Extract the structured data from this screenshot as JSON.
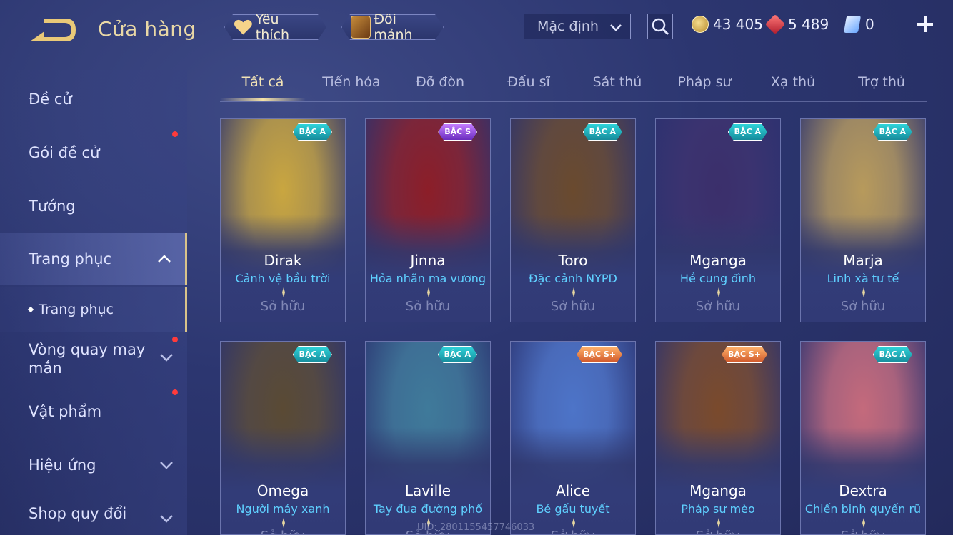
{
  "header": {
    "title": "Cửa hàng",
    "favorite_label": "Yêu thích",
    "fragment_label": "Đổi mảnh",
    "sort_value": "Mặc định"
  },
  "currency": {
    "gold": "43 405",
    "ruby": "5 489",
    "voucher": "0"
  },
  "sidebar": {
    "items": [
      {
        "label": "Đề cử"
      },
      {
        "label": "Gói đề cử"
      },
      {
        "label": "Tướng"
      },
      {
        "label": "Trang phục"
      },
      {
        "label": "Trang phục"
      },
      {
        "label": "Vòng quay may mắn"
      },
      {
        "label": "Vật phẩm"
      },
      {
        "label": "Hiệu ứng"
      },
      {
        "label": "Shop quy đổi"
      }
    ]
  },
  "tabs": [
    "Tất cả",
    "Tiến hóa",
    "Đỡ đòn",
    "Đấu sĩ",
    "Sát thủ",
    "Pháp sư",
    "Xạ thủ",
    "Trợ thủ"
  ],
  "cards": [
    {
      "tier": "BẬC A",
      "hero": "Dirak",
      "skin": "Cảnh vệ bầu trời",
      "status": "Sở hữu",
      "color": "#c9a640"
    },
    {
      "tier": "BẬC S",
      "hero": "Jinna",
      "skin": "Hỏa nhãn ma vương",
      "status": "Sở hữu",
      "color": "#8c1e28"
    },
    {
      "tier": "BẬC A",
      "hero": "Toro",
      "skin": "Đặc cảnh NYPD",
      "status": "Sở hữu",
      "color": "#6a4a2e"
    },
    {
      "tier": "BẬC A",
      "hero": "Mganga",
      "skin": "Hề cung đình",
      "status": "Sở hữu",
      "color": "#3b2f6b"
    },
    {
      "tier": "BẬC A",
      "hero": "Marja",
      "skin": "Linh xà tư tế",
      "status": "Sở hữu",
      "color": "#b79a5c"
    },
    {
      "tier": "BẬC A",
      "hero": "Omega",
      "skin": "Người máy xanh",
      "status": "Sở hữu",
      "color": "#5a4a34"
    },
    {
      "tier": "BẬC A",
      "hero": "Laville",
      "skin": "Tay đua đường phố",
      "status": "Sở hữu",
      "color": "#3f7a9a"
    },
    {
      "tier": "BẬC S+",
      "hero": "Alice",
      "skin": "Bé gấu tuyết",
      "status": "Sở hữu",
      "color": "#4d74c8"
    },
    {
      "tier": "BẬC S+",
      "hero": "Mganga",
      "skin": "Pháp sư mèo",
      "status": "Sở hữu",
      "color": "#7a4a2c"
    },
    {
      "tier": "BẬC A",
      "hero": "Dextra",
      "skin": "Chiến binh quyến rũ",
      "status": "Sở hữu",
      "color": "#c46a7c"
    }
  ],
  "footer": {
    "uid": "UID: 2801155457746033"
  }
}
